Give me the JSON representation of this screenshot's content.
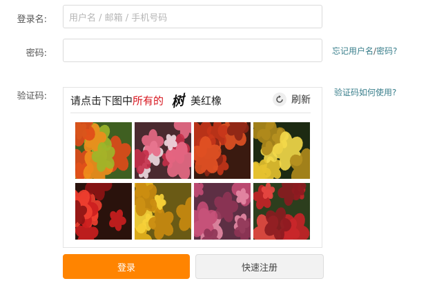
{
  "form": {
    "username_label": "登录名:",
    "username_placeholder": "用户名 / 邮箱 / 手机号码",
    "password_label": "密码:",
    "password_value": "",
    "captcha_label": "验证码:"
  },
  "links": {
    "forgot_username": "忘记用户名",
    "forgot_sep": "/",
    "forgot_password": "密码?",
    "captcha_help": "验证码如何使用?"
  },
  "captcha": {
    "instruction_prefix": "请点击下图中",
    "instruction_highlight": "所有的",
    "instruction_glyph": "树",
    "instruction_suffix": "美红橡",
    "refresh_label": "刷新",
    "highlight_color": "#d7151e",
    "tiles": [
      {
        "name": "captcha-image-1",
        "palette": [
          "#3f5f21",
          "#e04a1a",
          "#f08d1c",
          "#9cb72a"
        ]
      },
      {
        "name": "captcha-image-2",
        "palette": [
          "#4a2a2f",
          "#c7304a",
          "#e86a86",
          "#f0dce2"
        ]
      },
      {
        "name": "captcha-image-3",
        "palette": [
          "#3a1a10",
          "#c6351a",
          "#e25224",
          "#8a2515"
        ]
      },
      {
        "name": "captcha-image-4",
        "palette": [
          "#1d2a12",
          "#e7c230",
          "#f4d94a",
          "#b08a1c"
        ]
      },
      {
        "name": "captcha-image-5",
        "palette": [
          "#2a120c",
          "#cc1f1f",
          "#f04030",
          "#8e1414"
        ]
      },
      {
        "name": "captcha-image-6",
        "palette": [
          "#6a5a15",
          "#e7b21c",
          "#f7d23a",
          "#c98a10"
        ]
      },
      {
        "name": "captcha-image-7",
        "palette": [
          "#5d2f44",
          "#c44d76",
          "#e58aa5",
          "#8e3455"
        ]
      },
      {
        "name": "captcha-image-8",
        "palette": [
          "#2c3e1d",
          "#c72228",
          "#e84842",
          "#8b1b20"
        ]
      }
    ]
  },
  "buttons": {
    "login_label": "登录",
    "register_label": "快速注册",
    "login_color": "#ff8400"
  }
}
